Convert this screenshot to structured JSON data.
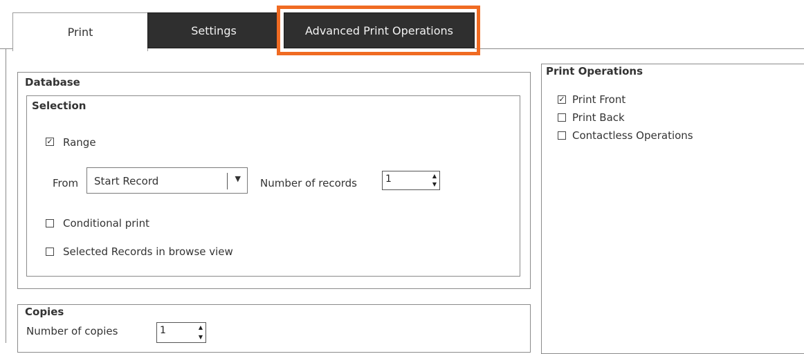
{
  "tabs": [
    {
      "label": "Print"
    },
    {
      "label": "Settings"
    },
    {
      "label": "Advanced Print Operations"
    }
  ],
  "database": {
    "title": "Database",
    "selection": {
      "title": "Selection",
      "range": {
        "label": "Range",
        "checked": true
      },
      "from_label": "From",
      "from_value": "Start Record",
      "records_label": "Number of records",
      "records_value": "1",
      "conditional": {
        "label": "Conditional print",
        "checked": false
      },
      "selected": {
        "label": "Selected Records in browse view",
        "checked": false
      }
    }
  },
  "copies": {
    "title": "Copies",
    "number_label": "Number of copies",
    "number_value": "1"
  },
  "print_operations": {
    "title": "Print Operations",
    "items": [
      {
        "label": "Print Front",
        "checked": true
      },
      {
        "label": "Print Back",
        "checked": false
      },
      {
        "label": "Contactless Operations",
        "checked": false
      }
    ]
  },
  "colors": {
    "highlight": "#f06b22",
    "tab_dark": "#2f2f2f"
  }
}
